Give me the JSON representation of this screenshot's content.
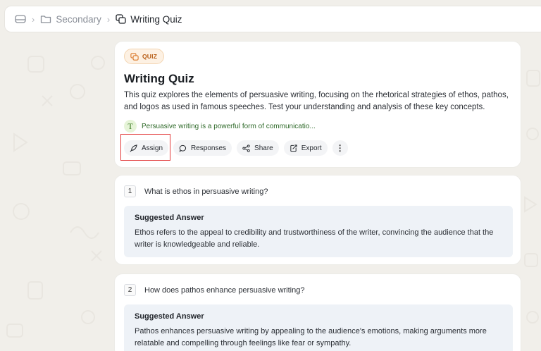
{
  "breadcrumb": {
    "root_icon": "drive-icon",
    "items": [
      {
        "label": "Secondary",
        "icon": "folder-icon"
      },
      {
        "label": "Writing Quiz",
        "icon": "quiz-icon"
      }
    ]
  },
  "quiz": {
    "badge": "QUIZ",
    "title": "Writing Quiz",
    "description": "This quiz explores the elements of persuasive writing, focusing on the rhetorical strategies of ethos, pathos, and logos as used in famous speeches. Test your understanding and analysis of these key concepts.",
    "note_avatar": "T",
    "note": "Persuasive writing is a powerful form of communicatio...",
    "actions": {
      "assign": "Assign",
      "responses": "Responses",
      "share": "Share",
      "export": "Export"
    }
  },
  "questions": [
    {
      "number": "1",
      "text": "What is ethos in persuasive writing?",
      "answer_title": "Suggested Answer",
      "answer": "Ethos refers to the appeal to credibility and trustworthiness of the writer, convincing the audience that the writer is knowledgeable and reliable."
    },
    {
      "number": "2",
      "text": "How does pathos enhance persuasive writing?",
      "answer_title": "Suggested Answer",
      "answer": "Pathos enhances persuasive writing by appealing to the audience's emotions, making arguments more relatable and compelling through feelings like fear or sympathy."
    }
  ],
  "colors": {
    "background": "#f1efea",
    "badge_accent": "#b65b12",
    "highlight": "#e23b3b",
    "note_text": "#2f6a2a"
  }
}
